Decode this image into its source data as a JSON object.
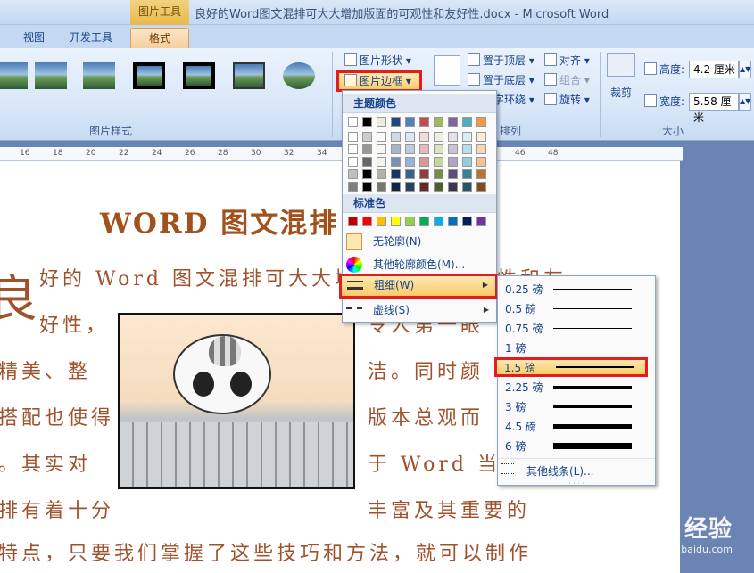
{
  "window": {
    "title": "良好的Word图文混排可大大增加版面的可观性和友好性.docx - Microsoft Word",
    "context_tools": "图片工具"
  },
  "tabs": [
    "视图",
    "开发工具",
    "格式"
  ],
  "ribbon": {
    "picture_styles_label": "图片样式",
    "picture_shape": "图片形状",
    "picture_border": "图片边框",
    "position_label": "位置",
    "bring_front": "置于顶层",
    "send_back": "置于底层",
    "text_wrap": "文字环绕",
    "align": "对齐",
    "group": "组合",
    "rotate": "旋转",
    "arrange_label": "排列",
    "crop": "裁剪",
    "height_label": "高度:",
    "height_value": "4.2 厘米",
    "width_label": "宽度:",
    "width_value": "5.58 厘米",
    "size_label": "大小"
  },
  "ruler": [
    "16",
    "18",
    "20",
    "22",
    "24",
    "26",
    "28",
    "30",
    "32",
    "34",
    "36",
    "38",
    "40",
    "42",
    "44",
    "46",
    "48"
  ],
  "document": {
    "title": "WORD 图文混排",
    "big_char": "良",
    "lines": [
      "好的 Word 图文混排可大大增加版面的可观性和友",
      "好性，",
      "令人第一眼",
      "精美、整",
      "洁。同时颜",
      "搭配也使得",
      "版本总观而",
      "。其实对",
      "于 Word 当中",
      "排有着十分",
      "丰富及其重要的",
      "特点，只要我们掌握了这些技巧和方法，就可以制作"
    ]
  },
  "color_menu": {
    "theme_colors_label": "主题颜色",
    "standard_colors_label": "标准色",
    "theme_top": [
      "#ffffff",
      "#000000",
      "#eeece1",
      "#1f497d",
      "#4f81bd",
      "#c0504d",
      "#9bbb59",
      "#8064a2",
      "#4bacc6",
      "#f79646"
    ],
    "standard": [
      "#c00000",
      "#ff0000",
      "#ffc000",
      "#ffff00",
      "#92d050",
      "#00b050",
      "#00b0f0",
      "#0070c0",
      "#002060",
      "#7030a0"
    ],
    "no_outline": "无轮廓(N)",
    "more_colors": "其他轮廓颜色(M)...",
    "weight": "粗细(W)",
    "dashes": "虚线(S)"
  },
  "weight_menu": {
    "options": [
      {
        "label": "0.25 磅",
        "pt": 0.25
      },
      {
        "label": "0.5 磅",
        "pt": 0.5
      },
      {
        "label": "0.75 磅",
        "pt": 0.75
      },
      {
        "label": "1 磅",
        "pt": 1
      },
      {
        "label": "1.5 磅",
        "pt": 1.5
      },
      {
        "label": "2.25 磅",
        "pt": 2.25
      },
      {
        "label": "3 磅",
        "pt": 3
      },
      {
        "label": "4.5 磅",
        "pt": 4.5
      },
      {
        "label": "6 磅",
        "pt": 6
      }
    ],
    "selected": "1.5 磅",
    "more_lines": "其他线条(L)..."
  },
  "watermark": {
    "logo": "Baidu 经验",
    "url": "jingyan.baidu.com"
  }
}
